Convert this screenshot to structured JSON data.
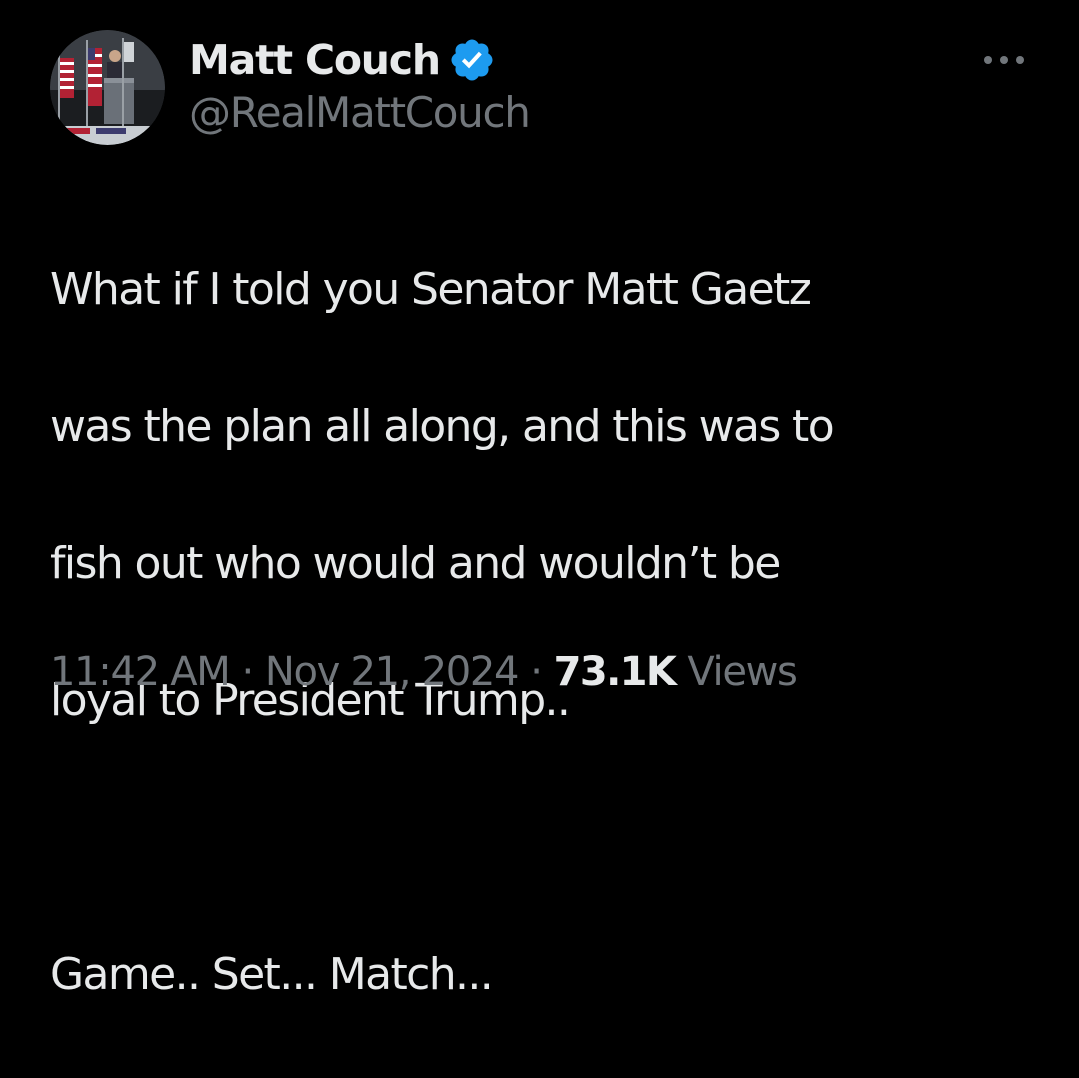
{
  "author": {
    "display_name": "Matt Couch",
    "handle": "@RealMattCouch",
    "verified": true,
    "verified_badge_color": "#1d9bf0"
  },
  "menu": {
    "icon": "more-horizontal-icon"
  },
  "tweet": {
    "lines": [
      "What if I told you Senator Matt Gaetz",
      "was the plan all along, and this was to",
      "fish out who would and wouldn’t be",
      "loyal to President Trump.."
    ],
    "closing_line": "Game.. Set... Match..."
  },
  "meta": {
    "time": "11:42 AM",
    "separator": "·",
    "date": "Nov 21, 2024",
    "views_count": "73.1K",
    "views_label": "Views"
  },
  "colors": {
    "background": "#000000",
    "primary_text": "#e7e9ea",
    "secondary_text": "#71767b",
    "accent": "#1d9bf0"
  }
}
